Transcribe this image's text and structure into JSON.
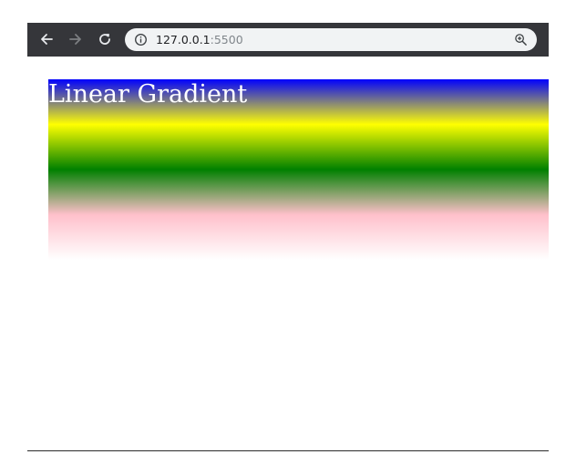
{
  "browser": {
    "back_icon": "arrow-left-icon",
    "forward_icon": "arrow-right-icon",
    "reload_icon": "reload-icon",
    "site_info_icon": "info-icon",
    "zoom_icon": "zoom-in-icon",
    "address": {
      "host": "127.0.0.1",
      "port": ":5500"
    },
    "colors": {
      "toolbar": "#35363a",
      "omnibox": "#f1f3f4"
    }
  },
  "page": {
    "heading": "Linear Gradient",
    "gradient": {
      "direction": "to bottom",
      "stops": [
        "blue",
        "yellow",
        "green",
        "pink",
        "white"
      ]
    }
  }
}
